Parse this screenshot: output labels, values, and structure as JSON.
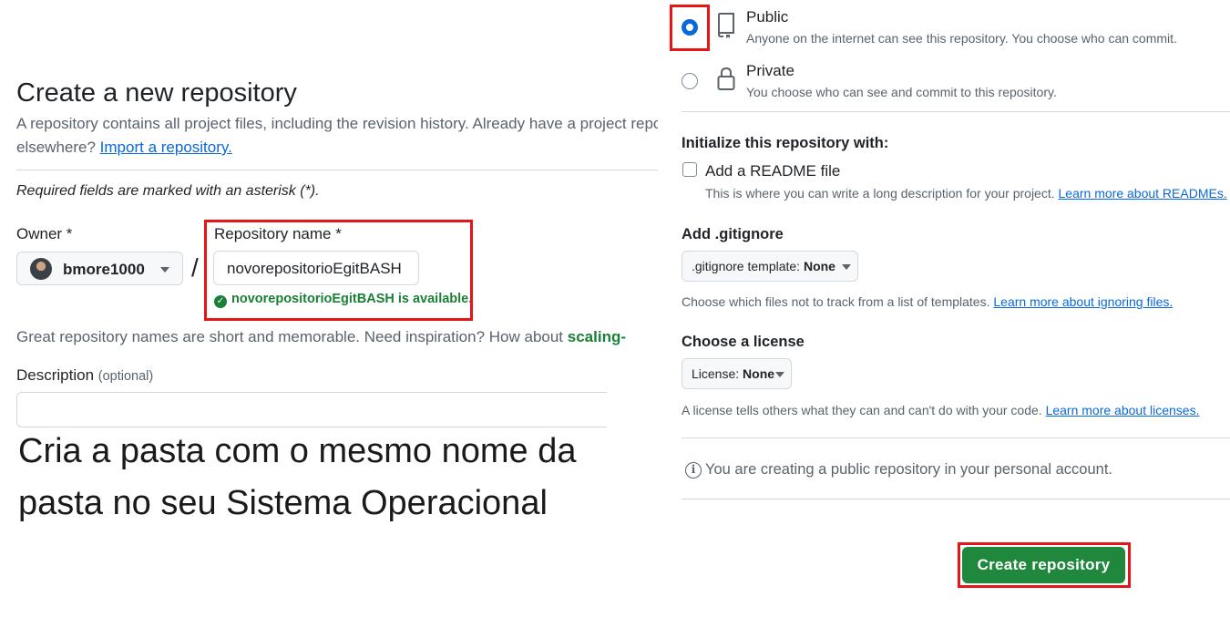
{
  "left": {
    "title": "Create a new repository",
    "intro_line1": "A repository contains all project files, including the revision history. Already have a project repository",
    "intro_line2_prefix": "elsewhere? ",
    "import_link": "Import a repository.",
    "required_note": "Required fields are marked with an asterisk (*).",
    "owner_label": "Owner *",
    "owner_name": "bmore1000",
    "slash": "/",
    "repo_label": "Repository name *",
    "repo_value": "novorepositorioEgitBASH",
    "available_msg": "novorepositorioEgitBASH is available.",
    "great_names_text": "Great repository names are short and memorable. Need inspiration? How about ",
    "suggestion": "scaling-",
    "description_label": "Description",
    "description_optional": "(optional)",
    "description_value": "",
    "overlay_line1": "Cria a pasta com o mesmo nome da",
    "overlay_line2": "pasta no seu Sistema Operacional"
  },
  "visibility": {
    "public_title": "Public",
    "public_desc": "Anyone on the internet can see this repository. You choose who can commit.",
    "private_title": "Private",
    "private_desc": "You choose who can see and commit to this repository.",
    "selected": "public"
  },
  "initialize": {
    "heading": "Initialize this repository with:",
    "readme_label": "Add a README file",
    "readme_checked": false,
    "readme_help": "This is where you can write a long description for your project. ",
    "readme_link": "Learn more about READMEs."
  },
  "gitignore": {
    "heading": "Add .gitignore",
    "select_prefix": ".gitignore template: ",
    "select_value": "None",
    "help": "Choose which files not to track from a list of templates. ",
    "link": "Learn more about ignoring files."
  },
  "license": {
    "heading": "Choose a license",
    "select_prefix": "License: ",
    "select_value": "None",
    "help": "A license tells others what they can and can't do with your code. ",
    "link": "Learn more about licenses."
  },
  "notice": {
    "text": "You are creating a public repository in your personal account."
  },
  "actions": {
    "create_label": "Create repository"
  },
  "colors": {
    "highlight_box": "#e51515",
    "primary_button": "#1f883d",
    "success_text": "#1a7f37",
    "link": "#0969da",
    "radio_selected": "#0969da"
  },
  "icons": {
    "public": "repo-book-icon",
    "private": "lock-icon",
    "available": "check-circle-icon",
    "notice": "info-icon",
    "dropdown": "triangle-down-icon"
  }
}
